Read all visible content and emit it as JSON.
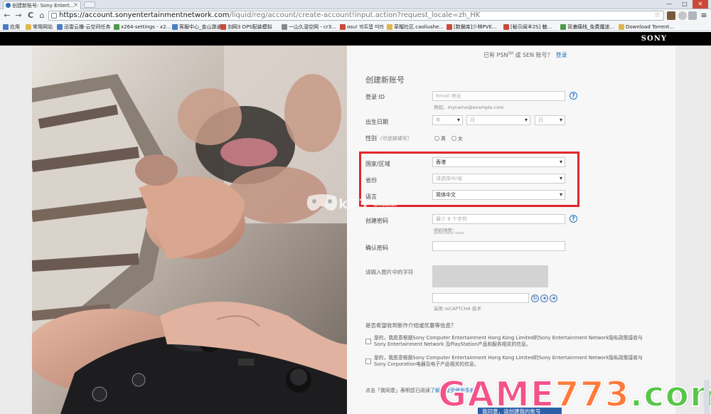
{
  "browser": {
    "tab_title": "创建新账号: Sony Entert...",
    "tab_close": "×",
    "window_controls": [
      "—",
      "□",
      "✕"
    ],
    "url_host": "https://account.sonyentertainmentnetwork.com",
    "url_path": "/liquid/reg/account/create-account!input.action?request_locale=zh_HK",
    "nav": [
      "←",
      "→",
      "C",
      "⌂"
    ],
    "bookmarks": [
      "应用",
      "常用网站",
      "迅雷云播-云空间任务",
      "x264-settings - x2...",
      "客服中心_金山游通...",
      "剑网3 DPS配装模拟",
      "一山久湿空网 - cr3...",
      "osu! 비트맵 미러",
      "草榴社区.caoliushe...",
      "[数据库]少林PVE...",
      "[秘示闻丰2S] 魅...",
      "背漉痛栈_免费魔迷...",
      "Download Torrent..."
    ]
  },
  "header": {
    "brand": "SONY"
  },
  "form": {
    "signin_prefix": "已有 PSN",
    "signin_sup": "SM",
    "signin_mid": " 或 SEN 账号？",
    "signin_link": "登录",
    "title": "创建新账号",
    "login_id_label": "登录 ID",
    "email_placeholder": "Email 地址",
    "email_example": "例如，myname@example.com",
    "birth_label": "出生日期",
    "year": "年",
    "month": "月",
    "day": "日",
    "gender_label": "性别",
    "gender_optional": "（可选择填写）",
    "male": "男",
    "female": "女",
    "country_label": "国家/区域",
    "country_value": "香港",
    "province_label": "省份",
    "province_placeholder": "请选择州/省",
    "language_label": "语言",
    "language_value": "简体中文",
    "password_label": "创建密码",
    "password_placeholder": "最少 8 个字符",
    "password_strength": "密码强度：",
    "confirm_label": "确认密码",
    "captcha_label": "请输入图片中的字符",
    "recaptcha_note": "采用 reCAPTCHA 技术",
    "help": "?",
    "newsletter_q": "是否希望收到新作介绍或优惠等信息？",
    "consent1_line1": "是的，我愿意根据Sony Computer Entertainment Hong Kong Limited的Sony Entertainment Network隐私政策接收与",
    "consent1_line2": "Sony Entertainment Network 及PlayStation产品和服务相关的信息。",
    "consent2_line1": "是的，我愿意根据Sony Computer Entertainment Hong Kong Limited的Sony Entertainment Network隐私政策接收与",
    "consent2_line2": "Sony Corporation电器及电子产品相关的信息。",
    "agree_prefix": "点击「我同意」表明您已阅读",
    "agree_link": "了解并接受使用条款",
    "submit_label": "我同意，请创建我的账号"
  },
  "watermarks": {
    "k73_main": "k73",
    "k73_sub": "电玩之家",
    "k73_com": ".com",
    "game_a": "GAME",
    "game_b": "773",
    "game_c": ".com"
  },
  "colors": {
    "highlight": "#e0262b",
    "link": "#1f6fbf",
    "sony_bar": "#000000"
  }
}
